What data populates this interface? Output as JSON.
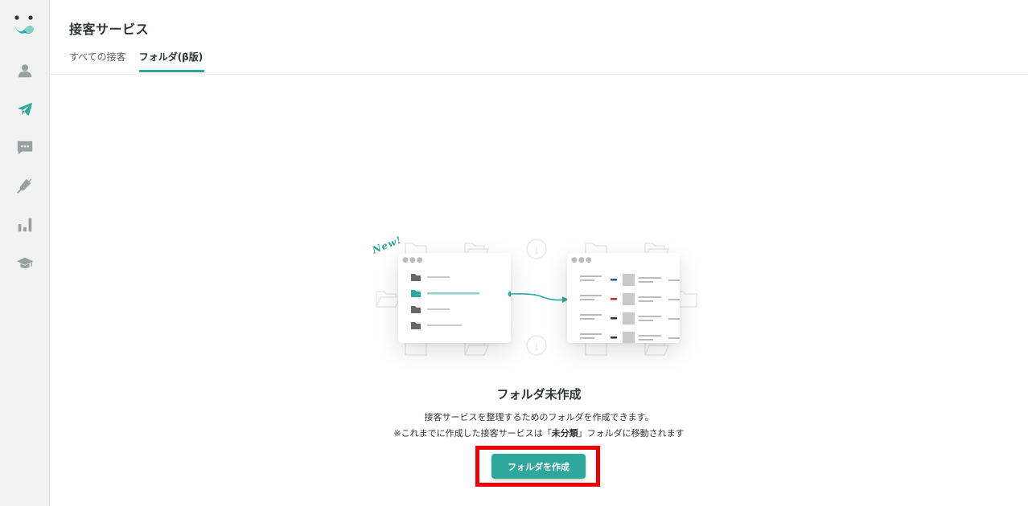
{
  "app": {
    "accent_color": "#2ea89c",
    "sidebar_bg": "#f1f3f3"
  },
  "sidebar": {
    "logo": "logo-icon",
    "items": [
      {
        "name": "user-icon",
        "active": false
      },
      {
        "name": "paper-plane-icon",
        "active": true
      },
      {
        "name": "chat-icon",
        "active": false
      },
      {
        "name": "plug-icon",
        "active": false
      },
      {
        "name": "bar-chart-icon",
        "active": false
      },
      {
        "name": "graduation-cap-icon",
        "active": false
      }
    ]
  },
  "header": {
    "title": "接客サービス",
    "tabs": [
      {
        "label": "すべての接客",
        "active": false
      },
      {
        "label": "フォルダ(β版)",
        "active": true
      }
    ]
  },
  "illustration": {
    "badge": "New!"
  },
  "empty_state": {
    "title": "フォルダ未作成",
    "description_line1": "接客サービスを整理するためのフォルダを作成できます。",
    "description_line2_prefix": "※これまでに作成した接客サービスは「",
    "description_line2_bold": "未分類",
    "description_line2_suffix": "」フォルダに移動されます",
    "button_label": "フォルダを作成"
  }
}
